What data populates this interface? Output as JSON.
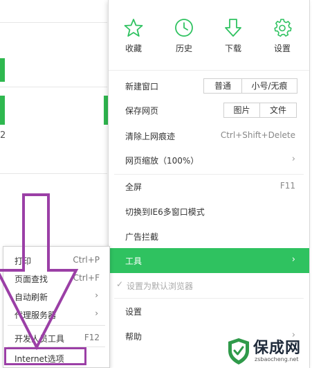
{
  "quick_actions": [
    {
      "label": "收藏",
      "icon": "star-icon"
    },
    {
      "label": "历史",
      "icon": "clock-icon"
    },
    {
      "label": "下载",
      "icon": "download-arrow-icon"
    },
    {
      "label": "设置",
      "icon": "gear-icon"
    }
  ],
  "menu": {
    "new_window": {
      "label": "新建窗口",
      "options": [
        "普通",
        "小号/无痕"
      ]
    },
    "save_page": {
      "label": "保存网页",
      "options": [
        "图片",
        "文件"
      ]
    },
    "clear_traces": {
      "label": "清除上网痕迹",
      "shortcut": "Ctrl+Shift+Delete"
    },
    "zoom": {
      "label": "网页缩放（100%）"
    },
    "fullscreen": {
      "label": "全屏",
      "shortcut": "F11"
    },
    "ie6_mode": {
      "label": "切换到IE6多窗口模式"
    },
    "ad_block": {
      "label": "广告拦截"
    },
    "tools": {
      "label": "工具"
    },
    "default_browser": {
      "label": "设置为默认浏览器"
    },
    "settings": {
      "label": "设置"
    },
    "help": {
      "label": "帮助"
    }
  },
  "background": {
    "partial_digit": "2"
  },
  "tools_submenu": [
    {
      "label": "打印",
      "shortcut": "Ctrl+P"
    },
    {
      "label": "页面查找",
      "shortcut": "Ctrl+F"
    },
    {
      "label": "自动刷新"
    },
    {
      "label": "代理服务器"
    },
    {
      "label": "开发人员工具",
      "shortcut": "F12"
    },
    {
      "label": "Internet选项"
    }
  ],
  "watermark": {
    "title": "保成网",
    "url": "zsbaocheng.net"
  },
  "colors": {
    "accent_green": "#2fc260",
    "annotation_purple": "#9b3fa6"
  }
}
